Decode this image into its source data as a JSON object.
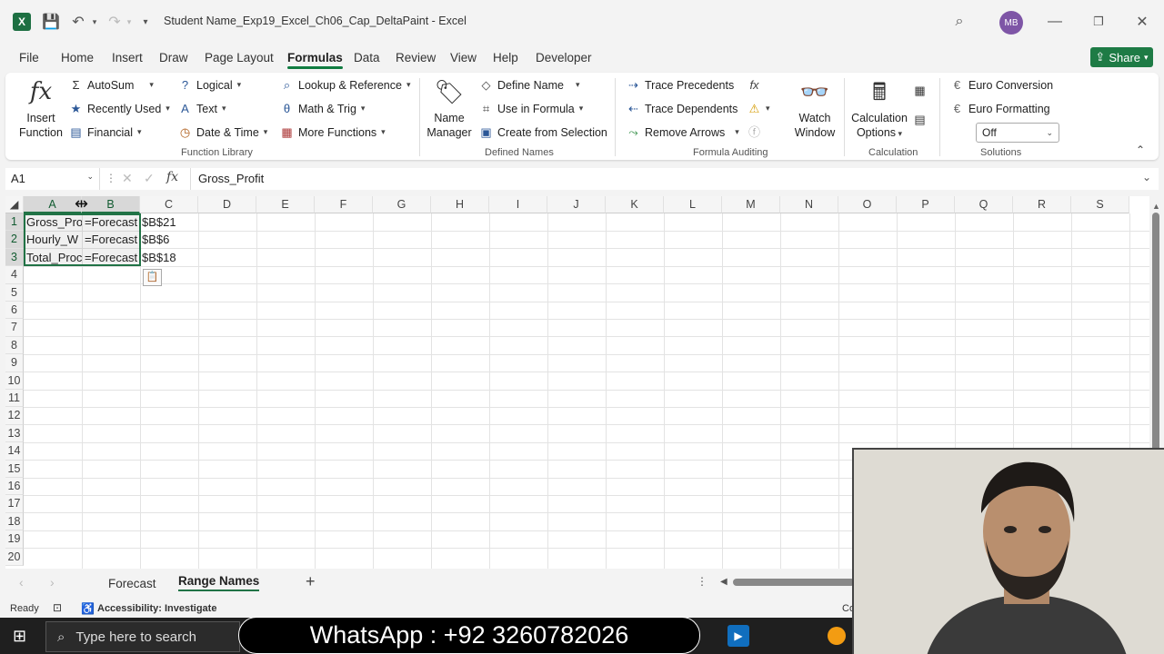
{
  "title_bar": {
    "document_title": "Student Name_Exp19_Excel_Ch06_Cap_DeltaPaint",
    "app_name": "Excel",
    "avatar_initials": "MB"
  },
  "menu_tabs": [
    "File",
    "Home",
    "Insert",
    "Draw",
    "Page Layout",
    "Formulas",
    "Data",
    "Review",
    "View",
    "Help",
    "Developer"
  ],
  "active_tab": "Formulas",
  "share_label": "Share",
  "ribbon": {
    "function_library": {
      "insert_function_line1": "Insert",
      "insert_function_line2": "Function",
      "autosum": "AutoSum",
      "recently_used": "Recently Used",
      "financial": "Financial",
      "logical": "Logical",
      "text": "Text",
      "date_time": "Date & Time",
      "lookup": "Lookup & Reference",
      "math_trig": "Math & Trig",
      "more_functions": "More Functions",
      "group_label": "Function Library"
    },
    "defined_names": {
      "name_manager_line1": "Name",
      "name_manager_line2": "Manager",
      "define_name": "Define Name",
      "use_in_formula": "Use in Formula",
      "create_from_selection": "Create from Selection",
      "group_label": "Defined Names"
    },
    "formula_auditing": {
      "trace_precedents": "Trace Precedents",
      "trace_dependents": "Trace Dependents",
      "remove_arrows": "Remove Arrows",
      "watch_window_line1": "Watch",
      "watch_window_line2": "Window",
      "group_label": "Formula Auditing"
    },
    "calculation": {
      "options_line1": "Calculation",
      "options_line2": "Options",
      "group_label": "Calculation"
    },
    "solutions": {
      "euro_conversion": "Euro Conversion",
      "euro_formatting": "Euro Formatting",
      "dropdown_value": "Off",
      "group_label": "Solutions"
    }
  },
  "formula_bar": {
    "name_box": "A1",
    "fx_label": "fx",
    "value": "Gross_Profit"
  },
  "columns": [
    "A",
    "B",
    "C",
    "D",
    "E",
    "F",
    "G",
    "H",
    "I",
    "J",
    "K",
    "L",
    "M",
    "N",
    "O",
    "P",
    "Q",
    "R",
    "S"
  ],
  "rows": [
    "1",
    "2",
    "3",
    "4",
    "5",
    "6",
    "7",
    "8",
    "9",
    "10",
    "11",
    "12",
    "13",
    "14",
    "15",
    "16",
    "17",
    "18",
    "19",
    "20"
  ],
  "cells": {
    "A1": "Gross_Pro",
    "B1": "=Forecast",
    "C1": "$B$21",
    "A2": "Hourly_W",
    "B2": "=Forecast",
    "C2": "$B$6",
    "A3": "Total_Proc",
    "B3": "=Forecast",
    "C3": "$B$18"
  },
  "sheets": [
    "Forecast",
    "Range Names"
  ],
  "active_sheet": "Range Names",
  "status": {
    "ready": "Ready",
    "accessibility": "Accessibility: Investigate",
    "partial_right": "Co"
  },
  "taskbar": {
    "search_placeholder": "Type here to search",
    "overlay_text": "WhatsApp : +92 3260782026"
  }
}
